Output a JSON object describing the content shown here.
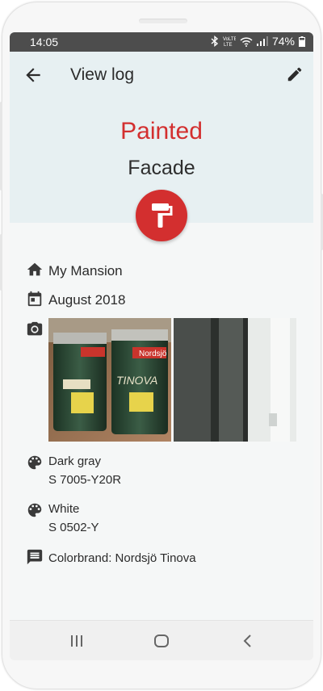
{
  "status_bar": {
    "time": "14:05",
    "battery_text": "74%",
    "icons": [
      "bluetooth-icon",
      "volte-icon",
      "wifi-icon",
      "signal-icon",
      "battery-icon"
    ]
  },
  "app_bar": {
    "title": "View log",
    "back_icon": "arrow-back-icon",
    "edit_icon": "pencil-icon"
  },
  "header": {
    "action": "Painted",
    "target": "Facade",
    "badge_icon": "paint-roller-icon",
    "action_color": "#d32f2f"
  },
  "details": {
    "property": "My Mansion",
    "date": "August 2018",
    "colors": [
      {
        "name": "Dark gray",
        "code": "S 7005-Y20R"
      },
      {
        "name": "White",
        "code": "S 0502-Y"
      }
    ],
    "note": "Colorbrand: Nordsjö Tinova"
  },
  "photos": [
    {
      "label": "paint-cans-photo",
      "brand_text": "Nordsjö",
      "product_text": "TINOVA"
    },
    {
      "label": "facade-photo"
    }
  ],
  "nav_bar": {
    "icons": [
      "recent-apps-icon",
      "home-icon",
      "back-icon"
    ]
  }
}
